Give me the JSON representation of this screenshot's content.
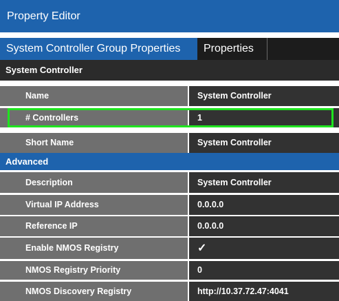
{
  "title": "Property Editor",
  "tabs": [
    {
      "label": "System Controller Group Properties"
    },
    {
      "label": "Properties"
    }
  ],
  "section_system": "System Controller",
  "section_advanced": "Advanced",
  "rows_system": [
    {
      "label": "Name",
      "value": "System Controller"
    },
    {
      "label": "# Controllers",
      "value": "1"
    },
    {
      "label": "Short Name",
      "value": "System Controller"
    }
  ],
  "rows_advanced": [
    {
      "label": "Description",
      "value": "System Controller"
    },
    {
      "label": "Virtual IP Address",
      "value": "0.0.0.0"
    },
    {
      "label": "Reference IP",
      "value": "0.0.0.0"
    },
    {
      "label": "Enable NMOS Registry",
      "value": "✓"
    },
    {
      "label": "NMOS Registry Priority",
      "value": "0"
    },
    {
      "label": "NMOS Discovery Registry",
      "value": "http://10.37.72.47:4041"
    }
  ],
  "colors": {
    "header_blue": "#1e63ad",
    "label_bg": "#6f6f6f",
    "value_bg": "#323232",
    "highlight": "#1fe41f"
  }
}
